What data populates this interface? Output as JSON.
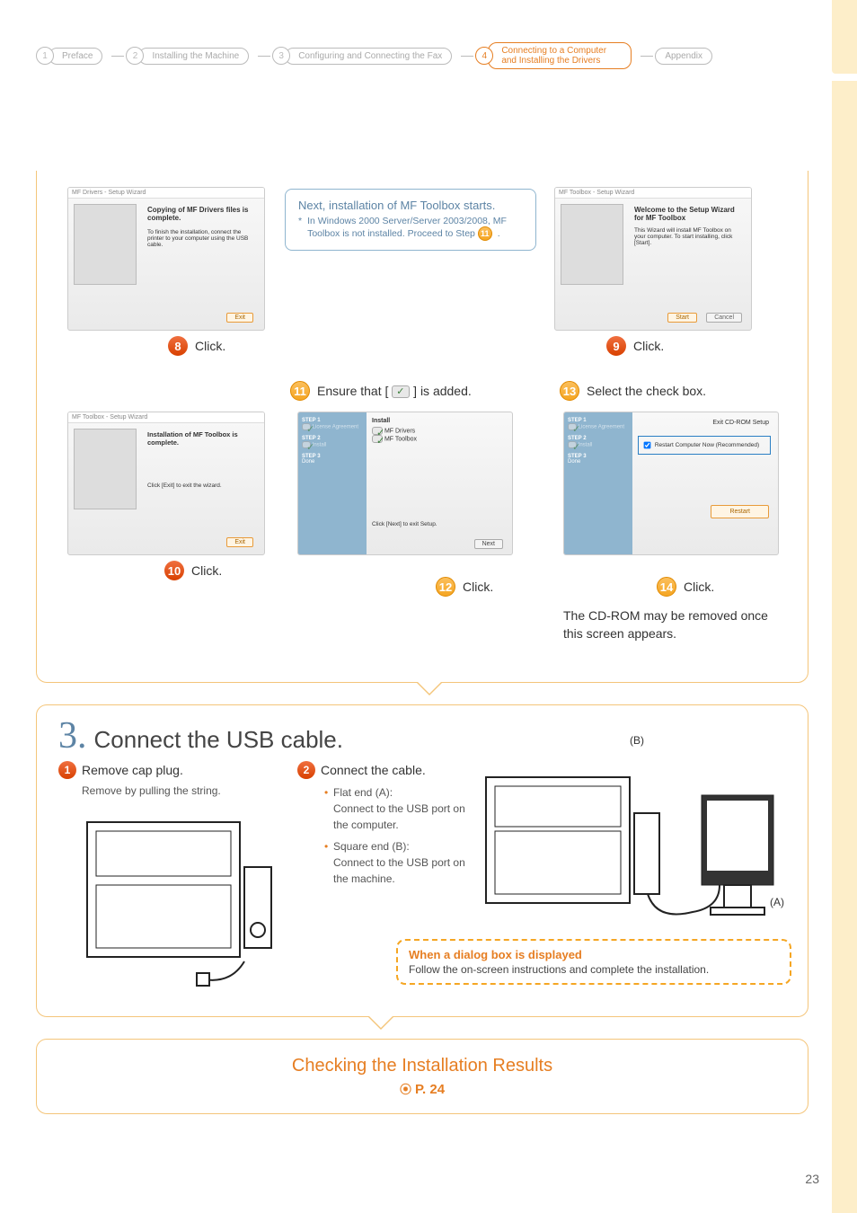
{
  "breadcrumb": {
    "items": [
      {
        "num": "1",
        "label": "Preface"
      },
      {
        "num": "2",
        "label": "Installing the Machine"
      },
      {
        "num": "3",
        "label": "Configuring and Connecting the Fax"
      },
      {
        "num": "4",
        "label": "Connecting to a Computer and Installing the Drivers"
      },
      {
        "num": "",
        "label": "Appendix"
      }
    ],
    "active_index": 3
  },
  "panel1": {
    "note_title": "Next, installation of MF Toolbox starts.",
    "note_asterisk": "*",
    "note_body_a": "In Windows 2000 Server/Server 2003/2008, MF Toolbox is not installed. Proceed to Step ",
    "note_step_ref": "11",
    "note_body_b": ".",
    "shot8": {
      "title": "MF Drivers - Setup Wizard",
      "heading": "Copying of MF Drivers files is complete.",
      "body": "To finish the installation, connect the printer to your computer using the USB cable.",
      "button": "Exit"
    },
    "step8": {
      "num": "8",
      "label": "Click."
    },
    "shot9": {
      "title": "MF Toolbox - Setup Wizard",
      "heading": "Welcome to the Setup Wizard for MF Toolbox",
      "body": "This Wizard will install MF Toolbox on your computer. To start installing, click [Start].",
      "button1": "Start",
      "button2": "Cancel"
    },
    "step9": {
      "num": "9",
      "label": "Click."
    },
    "shot10": {
      "title": "MF Toolbox - Setup Wizard",
      "heading": "Installation of MF Toolbox is complete.",
      "body": "Click [Exit] to exit the wizard.",
      "button": "Exit"
    },
    "step10": {
      "num": "10",
      "label": "Click."
    },
    "step11": {
      "num": "11",
      "label_a": "Ensure that [ ",
      "label_b": " ] is added."
    },
    "shot11": {
      "col_install": "Install",
      "step1": "STEP 1",
      "step1_label": "License Agreement",
      "step2": "STEP 2",
      "step2_label": "Install",
      "item1": "MF Drivers",
      "item2": "MF Toolbox",
      "step3": "STEP 3",
      "step3_label": "Done",
      "hint": "Click [Next] to exit Setup.",
      "button": "Next"
    },
    "step12": {
      "num": "12",
      "label": "Click."
    },
    "step13": {
      "num": "13",
      "label": "Select the check box."
    },
    "shot13": {
      "exit": "Exit CD-ROM Setup",
      "checkbox": "Restart Computer Now (Recommended)",
      "step1": "STEP 1",
      "step1_label": "License Agreement",
      "step2": "STEP 2",
      "step2_label": "Install",
      "step3": "STEP 3",
      "step3_label": "Done",
      "button": "Restart"
    },
    "step14": {
      "num": "14",
      "label": "Click."
    },
    "cd_note": "The CD-ROM may be removed once this screen appears."
  },
  "panel2": {
    "heading_num": "3.",
    "heading": "Connect the USB cable.",
    "step1": {
      "num": "1",
      "label": "Remove cap plug.",
      "desc": "Remove by pulling the string."
    },
    "step2": {
      "num": "2",
      "label": "Connect the cable.",
      "bullet1a": "Flat end (A):",
      "bullet1b": "Connect to the USB port on the computer.",
      "bullet2a": "Square end (B):",
      "bullet2b": "Connect to the USB port on the machine."
    },
    "label_a": "(A)",
    "label_b": "(B)",
    "dialog_heading": "When a dialog box is displayed",
    "dialog_body": "Follow the on-screen instructions and complete the installation."
  },
  "panel3": {
    "heading": "Checking the Installation Results",
    "pageref": "P. 24"
  },
  "page_number": "23"
}
